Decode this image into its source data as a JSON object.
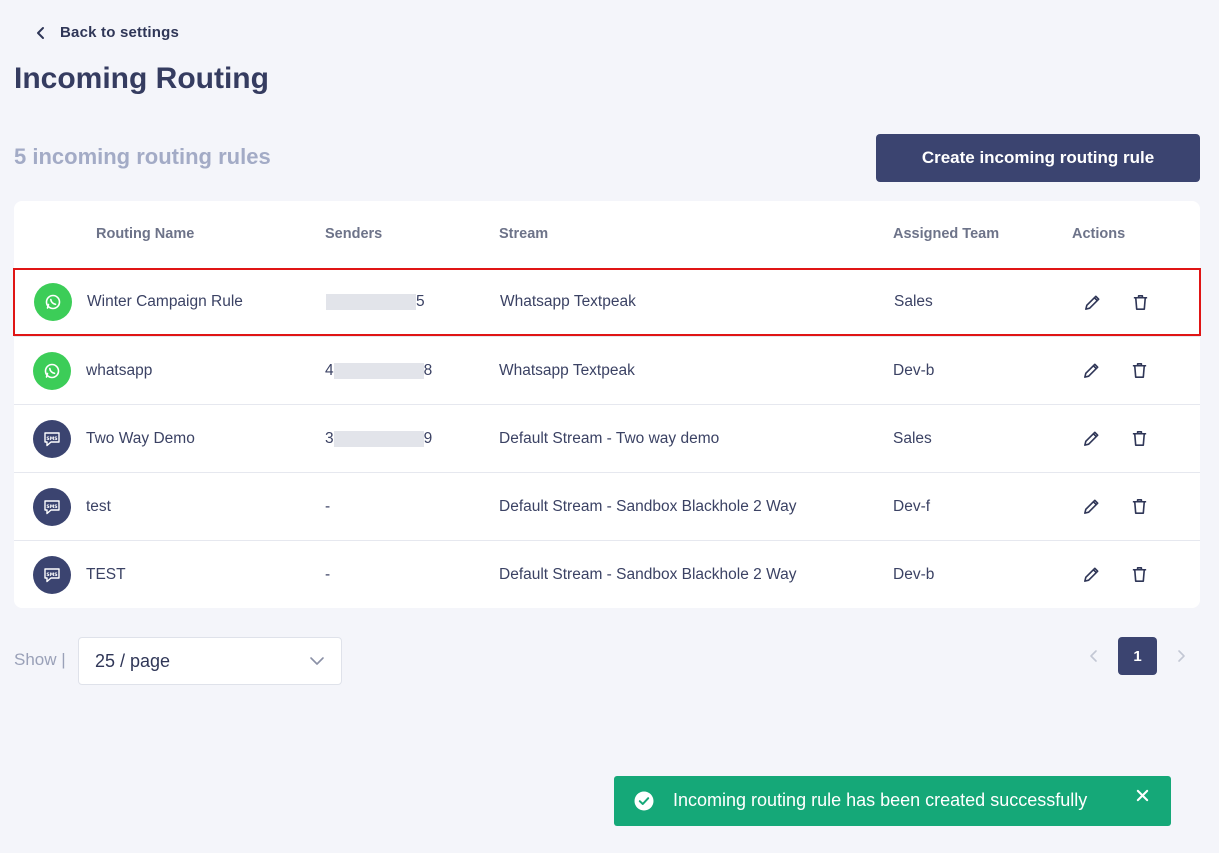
{
  "header": {
    "back_label": "Back to settings",
    "title": "Incoming Routing"
  },
  "toolbar": {
    "rule_count": "5 incoming routing rules",
    "create_label": "Create incoming routing rule"
  },
  "table": {
    "columns": [
      "Routing Name",
      "Senders",
      "Stream",
      "Assigned Team",
      "Actions"
    ],
    "rows": [
      {
        "channel": "whatsapp",
        "name": "Winter Campaign Rule",
        "sender_start": "",
        "sender_end": "5",
        "stream": "Whatsapp Textpeak",
        "team": "Sales"
      },
      {
        "channel": "whatsapp",
        "name": "whatsapp",
        "sender_start": "4",
        "sender_end": "8",
        "stream": "Whatsapp Textpeak",
        "team": "Dev-b"
      },
      {
        "channel": "sms",
        "name": "Two Way Demo",
        "sender_start": "3",
        "sender_end": "9",
        "stream": "Default Stream - Two way demo",
        "team": "Sales"
      },
      {
        "channel": "sms",
        "name": "test",
        "sender_start": "-",
        "sender_end": "",
        "stream": "Default Stream - Sandbox Blackhole 2 Way",
        "team": "Dev-f"
      },
      {
        "channel": "sms",
        "name": "TEST",
        "sender_start": "-",
        "sender_end": "",
        "stream": "Default Stream - Sandbox Blackhole 2 Way",
        "team": "Dev-b"
      }
    ]
  },
  "pagination": {
    "show_label": "Show |",
    "page_size": "25 / page",
    "current_page": "1"
  },
  "toast": {
    "message": "Incoming routing rule has been created successfully"
  },
  "icons": {
    "back": "chevron-left-icon",
    "whatsapp": "whatsapp-icon",
    "sms": "sms-bubble-icon",
    "edit": "pencil-icon",
    "delete": "trash-icon",
    "dropdown": "chevron-down-icon",
    "toast": "check-circle-icon",
    "close": "close-icon"
  },
  "colors": {
    "primary": "#3b4470",
    "whatsapp": "#3ccd58",
    "toast": "#15a878",
    "highlight": "#e01515"
  }
}
